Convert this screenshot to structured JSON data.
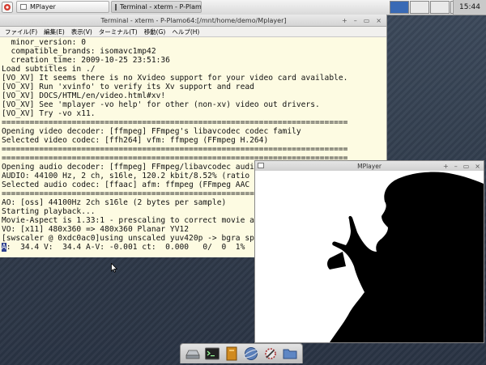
{
  "taskbar": {
    "tasks": [
      {
        "label": "MPlayer"
      },
      {
        "label": "Terminal - xterm - P-Plamo64:[/mnt/home/demo/Mplayer]"
      }
    ],
    "clock": "15:44"
  },
  "terminal": {
    "title": "Terminal - xterm - P-Plamo64:[/mnt/home/demo/Mplayer]",
    "controls": [
      "+",
      "–",
      "▭",
      "×"
    ],
    "menu": [
      "ファイル(F)",
      "編集(E)",
      "表示(V)",
      "ターミナル(T)",
      "移動(G)",
      "ヘルプ(H)"
    ],
    "lines": [
      "  minor_version: 0",
      "  compatible_brands: isomavc1mp42",
      "  creation_time: 2009-10-25 23:51:36",
      "Load subtitles in ./",
      "[VO_XV] It seems there is no Xvideo support for your video card available.",
      "[VO_XV] Run 'xvinfo' to verify its Xv support and read",
      "[VO_XV] DOCS/HTML/en/video.html#xv!",
      "[VO_XV] See 'mplayer -vo help' for other (non-xv) video out drivers.",
      "[VO_XV] Try -vo x11.",
      "==========================================================================",
      "Opening video decoder: [ffmpeg] FFmpeg's libavcodec codec family",
      "Selected video codec: [ffh264] vfm: ffmpeg (FFmpeg H.264)",
      "==========================================================================",
      "==========================================================================",
      "Opening audio decoder: [ffmpeg] FFmpeg/libavcodec audi",
      "AUDIO: 44100 Hz, 2 ch, s16le, 120.2 kbit/8.52% (ratio",
      "Selected audio codec: [ffaac] afm: ffmpeg (FFmpeg AAC",
      "==========================================================================",
      "AO: [oss] 44100Hz 2ch s16le (2 bytes per sample)",
      "Starting playback...",
      "Movie-Aspect is 1.33:1 - prescaling to correct movie a",
      "VO: [x11] 480x360 => 480x360 Planar YV12",
      "[swscaler @ 0xdc0ac0]using unscaled yuv420p -> bgra sp"
    ],
    "status_line_cursor": "A",
    "status_line_rest": ":  34.4 V:  34.4 A-V: -0.001 ct:  0.000   0/  0  1%"
  },
  "mplayer": {
    "title": "MPlayer",
    "controls": [
      "+",
      "–",
      "▭",
      "×"
    ]
  },
  "dock": {
    "items": [
      "drive-icon",
      "terminal-icon",
      "archive-icon",
      "globe-icon",
      "gear-icon",
      "folder-icon"
    ]
  },
  "colors": {
    "terminal_bg": "#fdfbe2",
    "desktop_bg": "#2f3a4a",
    "cursor_bg": "#2b3f8c"
  }
}
